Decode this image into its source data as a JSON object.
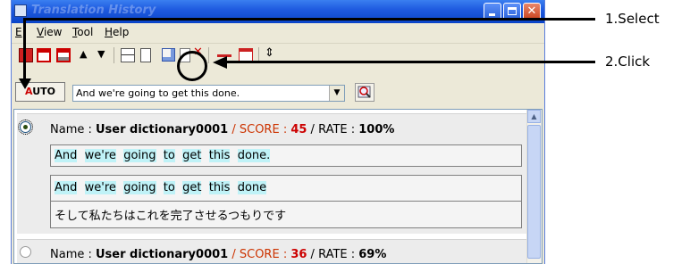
{
  "window": {
    "title": "Translation History",
    "colors": {
      "titlebar": "#0a44c8",
      "close": "#c8421e",
      "score": "#cc3300",
      "highlight": "#bff2f7"
    }
  },
  "menu": {
    "items": [
      {
        "label": "Edit",
        "visible": "E",
        "mnemonic": "d",
        "rest": "it"
      },
      {
        "label": "View",
        "mnemonic": "V",
        "rest": "iew"
      },
      {
        "label": "Tool",
        "mnemonic": "T",
        "rest": "ool"
      },
      {
        "label": "Help",
        "mnemonic": "H",
        "rest": "elp"
      }
    ]
  },
  "toolbar": {
    "icons": [
      "red-bookmark-icon",
      "dictionary-icon",
      "dictionary-list-icon",
      "up-arrow-icon",
      "down-arrow-icon",
      "list-view-icon",
      "text-view-icon",
      "register-dictionary-icon",
      "paste-icon",
      "delete-icon",
      "window-icon",
      "swap-icon"
    ]
  },
  "search_row": {
    "auto_label_a": "A",
    "auto_label_b": "UTO",
    "combo_value": "And we're going to get this done."
  },
  "entries": [
    {
      "name_label": "Name : ",
      "name": "User dictionary0001",
      "sep1": " / ",
      "score_label": "SCORE : ",
      "score": "45",
      "sep2": " / RATE : ",
      "rate": "100%",
      "source": "And we're going to get this done.",
      "match_source": "And we're going to get this done",
      "match_target": "そして私たちはこれを完了させるつもりです",
      "selected": true
    },
    {
      "name_label": "Name : ",
      "name": "User dictionary0001",
      "sep1": " / ",
      "score_label": "SCORE : ",
      "score": "36",
      "sep2": " / RATE : ",
      "rate": "69%",
      "selected": false
    }
  ],
  "annotations": {
    "step1": "1.Select",
    "step2": "2.Click"
  }
}
